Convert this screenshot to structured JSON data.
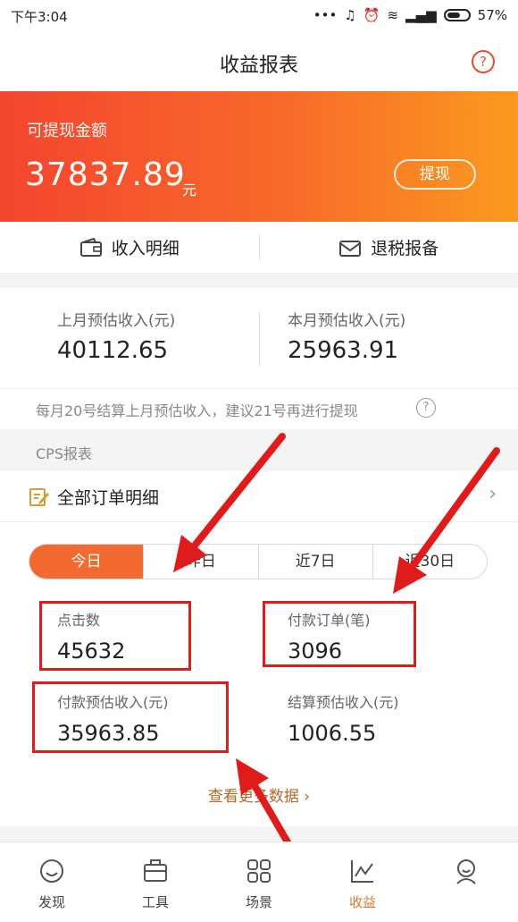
{
  "status": {
    "time": "下午3:04",
    "battery": "57%"
  },
  "nav": {
    "title": "收益报表",
    "help": "?"
  },
  "balance": {
    "label": "可提现金额",
    "amount": "37837.89",
    "unit": "元",
    "button": "提现"
  },
  "quick": [
    {
      "label": "收入明细",
      "icon": "wallet-icon"
    },
    {
      "label": "退税报备",
      "icon": "mail-icon"
    }
  ],
  "estimates": [
    {
      "label": "上月预估收入(元)",
      "value": "40112.65"
    },
    {
      "label": "本月预估收入(元)",
      "value": "25963.91"
    }
  ],
  "notice": {
    "text": "每月20号结算上月预估收入，建议21号再进行提现",
    "help": "?"
  },
  "section": {
    "title": "CPS报表"
  },
  "orders": {
    "label": "全部订单明细",
    "icon": "edit-icon"
  },
  "tabs": {
    "items": [
      "今日",
      "昨日",
      "近7日",
      "近30日"
    ],
    "active": "今日"
  },
  "metrics": [
    {
      "label": "点击数",
      "value": "45632"
    },
    {
      "label": "付款订单(笔)",
      "value": "3096"
    },
    {
      "label": "付款预估收入(元)",
      "value": "35963.85"
    },
    {
      "label": "结算预估收入(元)",
      "value": "1006.55"
    }
  ],
  "more": {
    "label": "查看更多数据"
  },
  "bottom_tabs": [
    {
      "label": "发现",
      "icon": "smile-icon"
    },
    {
      "label": "工具",
      "icon": "briefcase-icon"
    },
    {
      "label": "场景",
      "icon": "grid-icon"
    },
    {
      "label": "收益",
      "icon": "chart-icon",
      "active": true
    },
    {
      "label": "",
      "icon": "user-icon"
    }
  ],
  "colors": {
    "accent": "#f26a32",
    "banner_start": "#f4452f",
    "banner_end": "#fb9a1e",
    "annotation": "#e01b1b",
    "link": "#b26a2b"
  }
}
